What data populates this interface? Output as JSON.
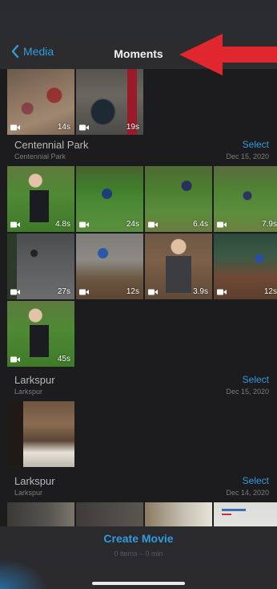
{
  "nav": {
    "back_label": "Media",
    "title": "Moments"
  },
  "sections": [
    {
      "title": "Centennial Park",
      "subtitle": "Centennial Park",
      "select_label": "Select",
      "date": "Dec 15, 2020"
    },
    {
      "title": "Larkspur",
      "subtitle": "Larkspur",
      "select_label": "Select",
      "date": "Dec 15, 2020"
    },
    {
      "title": "Larkspur",
      "subtitle": "Larkspur",
      "select_label": "Select",
      "date": "Dec 14, 2020"
    }
  ],
  "durations": {
    "top": [
      "14s",
      "19s"
    ],
    "grid": [
      "4.8s",
      "24s",
      "6.4s",
      "7.9s",
      "27s",
      "12s",
      "3.9s",
      "12s",
      "45s"
    ]
  },
  "bottom": {
    "create_label": "Create Movie",
    "summary": "0 items – 0 min"
  },
  "colors": {
    "accent": "#2f9be0",
    "annotation_arrow": "#e0262e",
    "background": "#1c1c1e"
  }
}
